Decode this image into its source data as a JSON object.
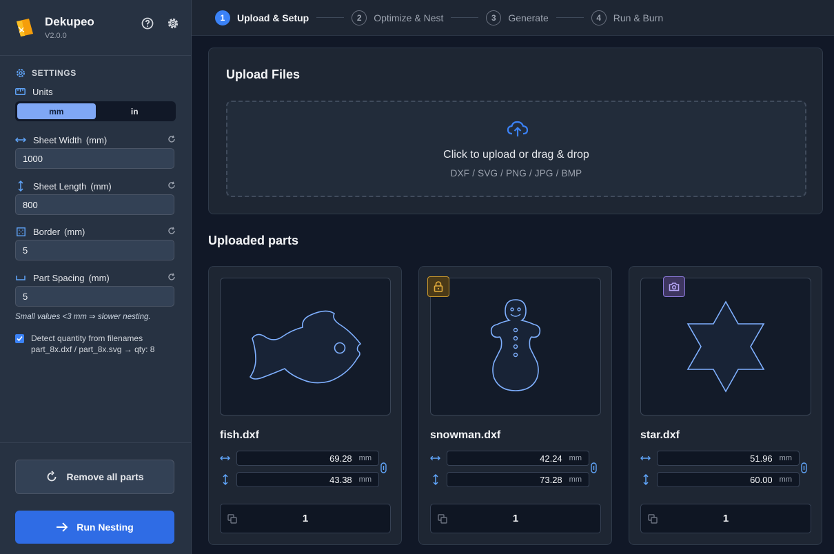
{
  "app": {
    "name": "Dekupeo",
    "version": "V2.0.0"
  },
  "settings": {
    "heading": "SETTINGS",
    "units_label": "Units",
    "units_options": [
      "mm",
      "in"
    ],
    "units_selected": "mm",
    "fields": [
      {
        "label": "Sheet Width",
        "unit": "(mm)",
        "value": "1000",
        "icon": "horizontal-arrows-icon"
      },
      {
        "label": "Sheet Length",
        "unit": "(mm)",
        "value": "800",
        "icon": "vertical-arrows-icon"
      },
      {
        "label": "Border",
        "unit": "(mm)",
        "value": "5",
        "icon": "border-icon"
      },
      {
        "label": "Part Spacing",
        "unit": "(mm)",
        "value": "5",
        "icon": "spacing-icon"
      }
    ],
    "hint": "Small values <3 mm ⇒ slower nesting.",
    "detect_qty": {
      "checked": true,
      "line1": "Detect quantity from filenames",
      "line2": "part_8x.dxf / part_8x.svg → qty: 8"
    }
  },
  "actions": {
    "remove_all": "Remove all parts",
    "run_nesting": "Run Nesting"
  },
  "steps": [
    {
      "num": "1",
      "label": "Upload & Setup",
      "active": true
    },
    {
      "num": "2",
      "label": "Optimize & Nest",
      "active": false
    },
    {
      "num": "3",
      "label": "Generate",
      "active": false
    },
    {
      "num": "4",
      "label": "Run & Burn",
      "active": false
    }
  ],
  "upload": {
    "title": "Upload Files",
    "prompt": "Click to upload or drag & drop",
    "formats": "DXF / SVG / PNG / JPG / BMP"
  },
  "parts_title": "Uploaded parts",
  "parts": [
    {
      "name": "fish.dxf",
      "width": "69.28",
      "height": "43.38",
      "unit": "mm",
      "qty": "1",
      "badge": ""
    },
    {
      "name": "snowman.dxf",
      "width": "42.24",
      "height": "73.28",
      "unit": "mm",
      "qty": "1",
      "badge": "lock-icon"
    },
    {
      "name": "star.dxf",
      "width": "51.96",
      "height": "60.00",
      "unit": "mm",
      "qty": "1",
      "badge": "camera-icon"
    }
  ],
  "colors": {
    "accent": "#3b82f6",
    "shape_stroke": "#7fb0ff",
    "lock_badge": "#c8972d",
    "camera_badge": "#8a78d8"
  }
}
